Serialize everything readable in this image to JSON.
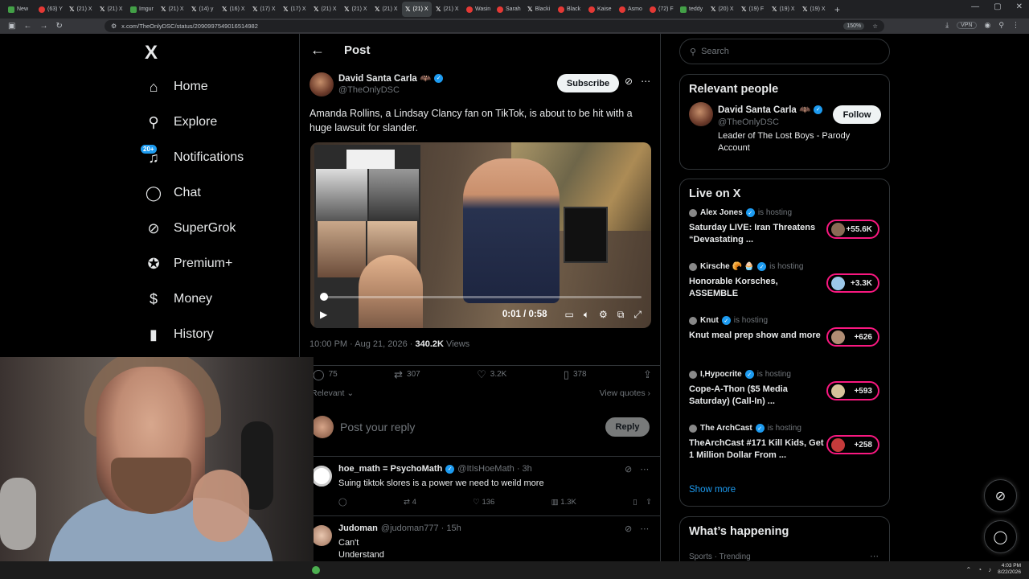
{
  "browser": {
    "tabs": [
      {
        "label": "New",
        "fav": "grn"
      },
      {
        "label": "(63) Y",
        "fav": "red"
      },
      {
        "label": "(21) X",
        "fav": "x"
      },
      {
        "label": "(21) X",
        "fav": "x"
      },
      {
        "label": "Imgur",
        "fav": "grn"
      },
      {
        "label": "(21) X",
        "fav": "x"
      },
      {
        "label": "(14) y",
        "fav": "x"
      },
      {
        "label": "(16) X",
        "fav": "x"
      },
      {
        "label": "(17) X",
        "fav": "x"
      },
      {
        "label": "(17) X",
        "fav": "x"
      },
      {
        "label": "(21) X",
        "fav": "x"
      },
      {
        "label": "(21) X",
        "fav": "x"
      },
      {
        "label": "(21) X",
        "fav": "x"
      },
      {
        "label": "(21) X",
        "fav": "x",
        "active": true
      },
      {
        "label": "(21) X",
        "fav": "x"
      },
      {
        "label": "Wasin",
        "fav": "red"
      },
      {
        "label": "Sarah",
        "fav": "red"
      },
      {
        "label": "Blacki",
        "fav": "x"
      },
      {
        "label": "Black",
        "fav": "red"
      },
      {
        "label": "Kaise",
        "fav": "red"
      },
      {
        "label": "Asmo",
        "fav": "red"
      },
      {
        "label": "(72) F",
        "fav": "red"
      },
      {
        "label": "teddy",
        "fav": "grn"
      },
      {
        "label": "(20) X",
        "fav": "x"
      },
      {
        "label": "(19) F",
        "fav": "x"
      },
      {
        "label": "(19) X",
        "fav": "x"
      },
      {
        "label": "(19) X",
        "fav": "x"
      }
    ],
    "url": "x.com/TheOnlyDSC/status/2090997549016514982",
    "zoom": "150%",
    "vpn": "VPN"
  },
  "nav": {
    "logo": "X",
    "items": [
      {
        "label": "Home",
        "icon": "⌂",
        "name": "home"
      },
      {
        "label": "Explore",
        "icon": "⚲",
        "name": "explore"
      },
      {
        "label": "Notifications",
        "icon": "♫",
        "name": "notifications",
        "badge": "20+"
      },
      {
        "label": "Chat",
        "icon": "◯",
        "name": "chat"
      },
      {
        "label": "SuperGrok",
        "icon": "⊘",
        "name": "supergrok"
      },
      {
        "label": "Premium+",
        "icon": "✪",
        "name": "premium"
      },
      {
        "label": "Money",
        "icon": "$",
        "name": "money"
      },
      {
        "label": "History",
        "icon": "▮",
        "name": "history"
      }
    ]
  },
  "post": {
    "header": "Post",
    "author_name": "David Santa Carla 🦇",
    "author_handle": "@TheOnlyDSC",
    "subscribe": "Subscribe",
    "text": "Amanda Rollins, a Lindsay Clancy fan on TikTok, is about to be hit with a huge lawsuit for slander.",
    "video_time": "0:01 / 0:58",
    "timestamp": "10:00 PM · Aug 21, 2026 · ",
    "views_count": "340.2K",
    "views_label": " Views",
    "replies": "75",
    "reposts": "307",
    "likes": "3.2K",
    "bookmarks": "378",
    "sort_label": "Relevant ⌄",
    "view_quotes": "View quotes ›",
    "reply_placeholder": "Post your reply",
    "reply_button": "Reply"
  },
  "replies": [
    {
      "name": "hoe_math = PsychoMath",
      "handle": "@ItIsHoeMath · 3h",
      "text": "Suing tiktok slores is a power we need to weild more",
      "replies": "",
      "reposts": "4",
      "likes": "136",
      "views": "1.3K"
    },
    {
      "name": "Judoman",
      "handle": "@judoman777 · 15h",
      "text": "Can't",
      "text2": "Understand"
    }
  ],
  "right": {
    "search_placeholder": "Search",
    "relevant_title": "Relevant people",
    "rp_name": "David Santa Carla 🦇",
    "rp_handle": "@TheOnlyDSC",
    "rp_bio": "Leader of The Lost Boys - Parody Account",
    "follow": "Follow",
    "live_title": "Live on X",
    "live": [
      {
        "host": "Alex Jones",
        "status": "is hosting",
        "title": "Saturday LIVE: Iran Threatens “Devastating ...",
        "count": "+55.6K"
      },
      {
        "host": "Kirsche 🥐 🧁",
        "status": "is hosting",
        "title": "Honorable Korsches, ASSEMBLE",
        "count": "+3.3K"
      },
      {
        "host": "Knut",
        "status": "is hosting",
        "title": "Knut meal prep show and more",
        "count": "+626"
      },
      {
        "host": "I,Hypocrite",
        "status": "is hosting",
        "title": "Cope-A-Thon ($5 Media Saturday) (Call-In) ...",
        "count": "+593"
      },
      {
        "host": "The ArchCast",
        "status": "is hosting",
        "title": "TheArchCast #171 Kill Kids, Get 1 Million Dollar From ...",
        "count": "+258"
      }
    ],
    "show_more": "Show more",
    "happening_title": "What’s happening",
    "happening_sub": "Sports · Trending"
  },
  "taskbar": {
    "time": "4:03 PM",
    "date": "8/22/2026"
  }
}
